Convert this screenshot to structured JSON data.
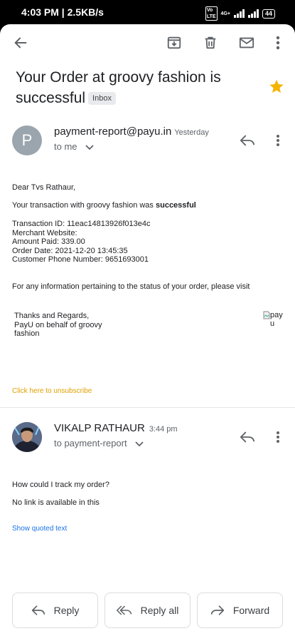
{
  "status_bar": {
    "time": "4:03 PM | 2.5KB/s",
    "volte": "VoLTE",
    "network": "4G+",
    "battery": "44"
  },
  "toolbar": {
    "back_icon": "arrow-left-icon",
    "archive_icon": "archive-icon",
    "delete_icon": "trash-icon",
    "mark_unread_icon": "mail-icon",
    "more_icon": "more-vertical-icon"
  },
  "subject": {
    "text": "Your Order at groovy fashion is successful",
    "label": "Inbox",
    "starred": true,
    "star_color": "#f4b400"
  },
  "message1": {
    "avatar_letter": "P",
    "sender": "payment-report@payu.in",
    "time": "Yesterday",
    "recipient": "to me",
    "greeting": "Dear  Tvs Rathaur,",
    "status_line_prefix": "Your transaction with groovy fashion was ",
    "status_line_bold": "successful",
    "details": [
      "Transaction ID: 11eac14813926f013e4c",
      "Merchant Website:",
      "Amount Paid: 339.00",
      "Order Date: 2021-12-20 13:45:35",
      "Customer Phone Number: 9651693001"
    ],
    "info_line": "For any information pertaining to the status of your order, please visit",
    "signature": [
      "Thanks and Regards,",
      "PayU on behalf of groovy",
      "fashion"
    ],
    "image_alt": "payu",
    "unsubscribe": "Click here to unsubscribe",
    "unsubscribe_color": "#e0a000"
  },
  "message2": {
    "sender": "VIKALP RATHAUR",
    "time": "3:44 pm",
    "recipient": "to payment-report",
    "lines": [
      "How could I track my order?",
      "No link is available in this"
    ],
    "show_quoted": "Show quoted text"
  },
  "actions": {
    "reply": "Reply",
    "reply_all": "Reply all",
    "forward": "Forward"
  }
}
